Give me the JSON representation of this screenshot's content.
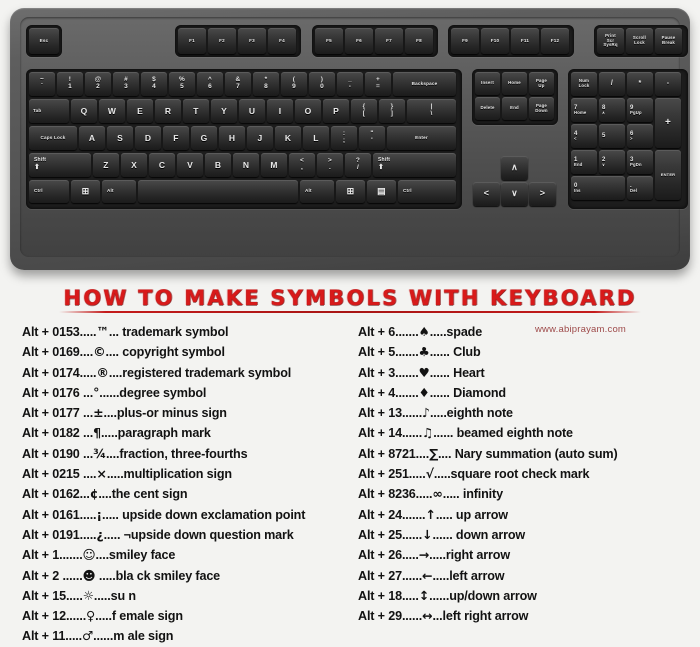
{
  "banner": {
    "title": "HOW  TO  MAKE  SYMBOLS  WITH  KEYBOARD",
    "site_url": "www.abiprayam.com",
    "title_color": "#d81a1a",
    "url_color": "#9e4a4a"
  },
  "keyboard": {
    "body_color": "#545454",
    "key_color": "#2b2b2b",
    "legend_color": "#e8e8e8",
    "function_row": {
      "escape": "Esc",
      "group1": [
        "F1",
        "F2",
        "F3",
        "F4"
      ],
      "group2": [
        "F5",
        "F6",
        "F7",
        "F8"
      ],
      "group3": [
        "F9",
        "F10",
        "F11",
        "F12"
      ],
      "system": [
        {
          "l1": "Print",
          "l2": "Scr",
          "l3": "SysRq"
        },
        {
          "l1": "Scroll",
          "l2": "Lock",
          "l3": ""
        },
        {
          "l1": "Pause",
          "l2": "Break",
          "l3": ""
        }
      ]
    },
    "number_row": [
      {
        "top": "~",
        "bot": "`"
      },
      {
        "top": "!",
        "bot": "1"
      },
      {
        "top": "@",
        "bot": "2"
      },
      {
        "top": "#",
        "bot": "3"
      },
      {
        "top": "$",
        "bot": "4"
      },
      {
        "top": "%",
        "bot": "5"
      },
      {
        "top": "^",
        "bot": "6"
      },
      {
        "top": "&",
        "bot": "7"
      },
      {
        "top": "*",
        "bot": "8"
      },
      {
        "top": "(",
        "bot": "9"
      },
      {
        "top": ")",
        "bot": "0"
      },
      {
        "top": "_",
        "bot": "-"
      },
      {
        "top": "+",
        "bot": "="
      }
    ],
    "backspace": "Backspace",
    "tab": "Tab",
    "qwerty_row": [
      "Q",
      "W",
      "E",
      "R",
      "T",
      "Y",
      "U",
      "I",
      "O",
      "P"
    ],
    "qwerty_extra": [
      {
        "top": "{",
        "bot": "["
      },
      {
        "top": "}",
        "bot": "]"
      },
      {
        "top": "|",
        "bot": "\\"
      }
    ],
    "caps_lock": "Caps Lock",
    "home_row": [
      "A",
      "S",
      "D",
      "F",
      "G",
      "H",
      "J",
      "K",
      "L"
    ],
    "home_extra": [
      {
        "top": ":",
        "bot": ";"
      },
      {
        "top": "\"",
        "bot": "'"
      }
    ],
    "enter": "Enter",
    "shift_left": "Shift",
    "shift_right": "Shift",
    "shift_arrow": "⬆",
    "zxcv_row": [
      "Z",
      "X",
      "C",
      "V",
      "B",
      "N",
      "M"
    ],
    "zxcv_extra": [
      {
        "top": "<",
        "bot": ","
      },
      {
        "top": ">",
        "bot": "."
      },
      {
        "top": "?",
        "bot": "/"
      }
    ],
    "bottom_row": {
      "ctrl_left": "Ctrl",
      "win_left": "⊞",
      "alt_left": "Alt",
      "space": "",
      "alt_right": "Alt",
      "win_right": "⊞",
      "menu": "▤",
      "ctrl_right": "Ctrl"
    },
    "nav_cluster": [
      {
        "l1": "Insert",
        "l2": ""
      },
      {
        "l1": "Home",
        "l2": ""
      },
      {
        "l1": "Page",
        "l2": "Up"
      },
      {
        "l1": "Delete",
        "l2": ""
      },
      {
        "l1": "End",
        "l2": ""
      },
      {
        "l1": "Page",
        "l2": "Down"
      }
    ],
    "arrow_keys": {
      "up": "∧",
      "left": "<",
      "down": "∨",
      "right": ">"
    },
    "numpad": {
      "num_lock": {
        "l1": "Num",
        "l2": "Lock"
      },
      "divide": "/",
      "multiply": "*",
      "subtract": "-",
      "add": "+",
      "enter": "ENTER",
      "keys": [
        {
          "n": "7",
          "f": "Home"
        },
        {
          "n": "8",
          "f": "∧"
        },
        {
          "n": "9",
          "f": "PgUp"
        },
        {
          "n": "4",
          "f": "<"
        },
        {
          "n": "5",
          "f": ""
        },
        {
          "n": "6",
          "f": ">"
        },
        {
          "n": "1",
          "f": "End"
        },
        {
          "n": "2",
          "f": "∨"
        },
        {
          "n": "3",
          "f": "PgDn"
        },
        {
          "n": "0",
          "f": "Ins"
        },
        {
          "n": ".",
          "f": "Del"
        }
      ]
    }
  },
  "symbol_table": {
    "left_column": [
      {
        "code": "Alt + 0153.....",
        "symbol": "™",
        "desc": "... trademark symbol"
      },
      {
        "code": "Alt + 0169....",
        "symbol": "©",
        "desc": ".... copyright symbol"
      },
      {
        "code": "Alt + 0174.....",
        "symbol": "®",
        "desc": "....registered  trademark symbol"
      },
      {
        "code": "Alt + 0176 ...",
        "symbol": "°",
        "desc": "......degree symbol"
      },
      {
        "code": "Alt + 0177 ...",
        "symbol": "±",
        "desc": "....plus-or minus sign"
      },
      {
        "code": "Alt + 0182 ...",
        "symbol": "¶",
        "desc": ".....paragraph mark"
      },
      {
        "code": "Alt + 0190 ...",
        "symbol": "¾",
        "desc": "....fraction, three-fourths"
      },
      {
        "code": "Alt + 0215 ....",
        "symbol": "×",
        "desc": ".....multiplication sign"
      },
      {
        "code": "Alt + 0162...",
        "symbol": "¢",
        "desc": "....the cent sign"
      },
      {
        "code": "Alt + 0161.....",
        "symbol": "¡",
        "desc": "..... upside down exclamation point"
      },
      {
        "code": "Alt + 0191.....",
        "symbol": "¿",
        "desc": "..... ¬upside down question mark"
      },
      {
        "code": "Alt + 1.......",
        "symbol": "☺",
        "desc": "....smiley face"
      },
      {
        "code": "Alt + 2 ......",
        "symbol": "☻",
        "desc": " .....bla ck smiley face"
      },
      {
        "code": "Alt + 15.....",
        "symbol": "☼",
        "desc": ".....su n"
      },
      {
        "code": "Alt + 12......",
        "symbol": "♀",
        "desc": ".....f emale sign"
      },
      {
        "code": "Alt + 11.....",
        "symbol": "♂",
        "desc": "......m ale sign"
      }
    ],
    "right_column": [
      {
        "code": "Alt + 6.......",
        "symbol": "♠",
        "desc": ".....spade"
      },
      {
        "code": "Alt + 5.......",
        "symbol": "♣",
        "desc": "...... Club"
      },
      {
        "code": "Alt + 3.......",
        "symbol": "♥",
        "desc": "...... Heart"
      },
      {
        "code": "Alt + 4.......",
        "symbol": "♦",
        "desc": "...... Diamond"
      },
      {
        "code": "Alt + 13......",
        "symbol": "♪",
        "desc": ".....eighth note"
      },
      {
        "code": "Alt + 14......",
        "symbol": "♫",
        "desc": "...... beamed eighth note"
      },
      {
        "code": "Alt + 8721....",
        "symbol": "∑",
        "desc": ".... Nary summation (auto sum)"
      },
      {
        "code": "Alt + 251.....",
        "symbol": "√",
        "desc": ".....square root check mark"
      },
      {
        "code": "Alt + 8236.....",
        "symbol": "∞",
        "desc": "..... infinity"
      },
      {
        "code": "Alt + 24.......",
        "symbol": "↑",
        "desc": "..... up arrow"
      },
      {
        "code": "Alt + 25......",
        "symbol": "↓",
        "desc": "...... down arrow"
      },
      {
        "code": "Alt + 26.....",
        "symbol": "→",
        "desc": ".....right arrow"
      },
      {
        "code": "Alt + 27......",
        "symbol": "←",
        "desc": ".....left arrow"
      },
      {
        "code": "Alt + 18.....",
        "symbol": "↕",
        "desc": "......up/down arrow"
      },
      {
        "code": "Alt + 29......",
        "symbol": "↔",
        "desc": "...left right arrow"
      }
    ]
  }
}
